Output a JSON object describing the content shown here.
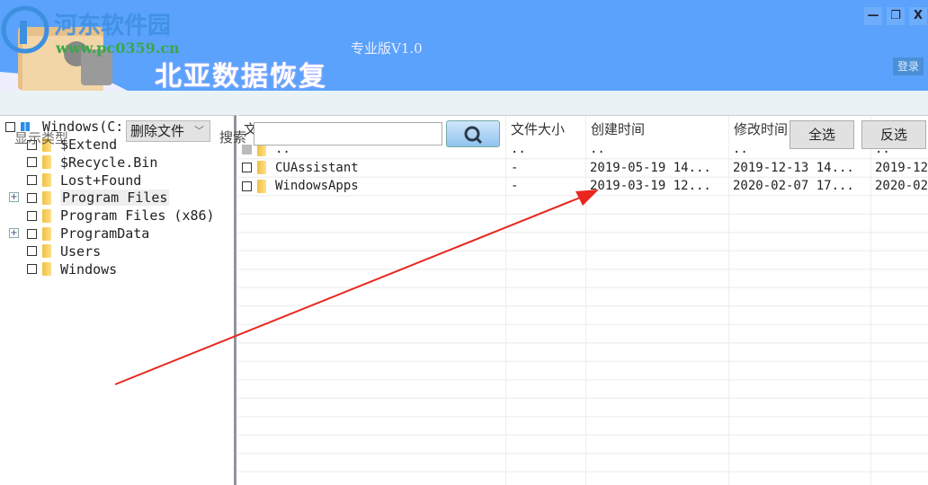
{
  "header": {
    "watermark_site": "河东软件园",
    "watermark_url": "www.pc0359.cn",
    "title": "北亚数据恢复",
    "edition": "专业版V1.0",
    "login": "登录",
    "minimize": "—",
    "restore": "❐",
    "close": "X"
  },
  "toolbar": {
    "display_type_label": "显示类型",
    "delete_dropdown": "删除文件",
    "search_label": "搜索",
    "search_value": "",
    "select_all": "全选",
    "invert_select": "反选"
  },
  "tree": {
    "root": "Windows(C:)",
    "items": [
      {
        "label": "$Extend",
        "expandable": false
      },
      {
        "label": "$Recycle.Bin",
        "expandable": false
      },
      {
        "label": "Lost+Found",
        "expandable": false
      },
      {
        "label": "Program Files",
        "expandable": true
      },
      {
        "label": "Program Files (x86)",
        "expandable": false
      },
      {
        "label": "ProgramData",
        "expandable": true
      },
      {
        "label": "Users",
        "expandable": false
      },
      {
        "label": "Windows",
        "expandable": false
      }
    ]
  },
  "list": {
    "columns": [
      "文件名",
      "文件大小",
      "创建时间",
      "修改时间",
      ""
    ],
    "rows": [
      {
        "name": "..",
        "size": "..",
        "created": "..",
        "modified": "..",
        "accessed": ".."
      },
      {
        "name": "CUAssistant",
        "size": "-",
        "created": "2019-05-19 14...",
        "modified": "2019-12-13 14...",
        "accessed": "2019-12"
      },
      {
        "name": "WindowsApps",
        "size": "-",
        "created": "2019-03-19 12...",
        "modified": "2020-02-07 17...",
        "accessed": "2020-02"
      }
    ]
  },
  "colors": {
    "header": "#5aa2fb",
    "arrow": "#e8261e"
  }
}
